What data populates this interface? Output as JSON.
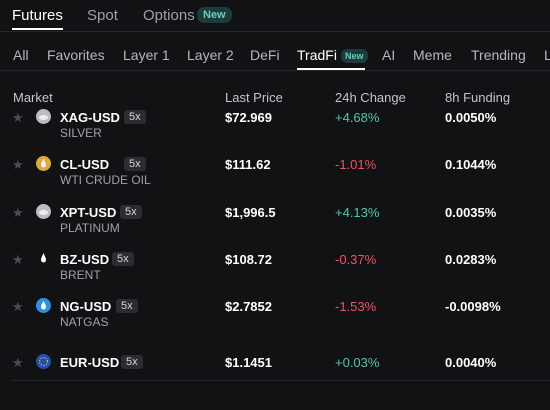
{
  "top_tabs": [
    {
      "label": "Futures",
      "active": true
    },
    {
      "label": "Spot",
      "active": false
    },
    {
      "label": "Options",
      "active": false,
      "badge": "New"
    }
  ],
  "category_tabs": [
    {
      "label": "All"
    },
    {
      "label": "Favorites"
    },
    {
      "label": "Layer 1"
    },
    {
      "label": "Layer 2"
    },
    {
      "label": "DeFi"
    },
    {
      "label": "TradFi",
      "active": true,
      "badge": "New"
    },
    {
      "label": "AI"
    },
    {
      "label": "Meme"
    },
    {
      "label": "Trending"
    },
    {
      "label": "L"
    }
  ],
  "columns": {
    "market": "Market",
    "last_price": "Last Price",
    "change": "24h Change",
    "funding": "8h Funding"
  },
  "rows": [
    {
      "symbol": "XAG-USD",
      "leverage": "5x",
      "name": "SILVER",
      "price": "$72.969",
      "change": "+4.68%",
      "change_dir": "pos",
      "funding": "0.0050%",
      "icon": "silver-coin-icon",
      "icon_color": "#b9bcc0"
    },
    {
      "symbol": "CL-USD",
      "leverage": "5x",
      "name": "WTI CRUDE OIL",
      "price": "$111.62",
      "change": "-1.01%",
      "change_dir": "neg",
      "funding": "0.1044%",
      "icon": "oil-drop-icon",
      "icon_color": "#e2a93a"
    },
    {
      "symbol": "XPT-USD",
      "leverage": "5x",
      "name": "PLATINUM",
      "price": "$1,996.5",
      "change": "+4.13%",
      "change_dir": "pos",
      "funding": "0.0035%",
      "icon": "platinum-coin-icon",
      "icon_color": "#b9bcc0"
    },
    {
      "symbol": "BZ-USD",
      "leverage": "5x",
      "name": "BRENT",
      "price": "$108.72",
      "change": "-0.37%",
      "change_dir": "neg",
      "funding": "0.0283%",
      "icon": "brent-drop-icon",
      "icon_color": "#111214"
    },
    {
      "symbol": "NG-USD",
      "leverage": "5x",
      "name": "NATGAS",
      "price": "$2.7852",
      "change": "-1.53%",
      "change_dir": "neg",
      "funding": "-0.0098%",
      "icon": "gas-flame-icon",
      "icon_color": "#2e8fe8"
    },
    {
      "symbol": "EUR-USD",
      "leverage": "5x",
      "name": "",
      "price": "$1.1451",
      "change": "+0.03%",
      "change_dir": "pos",
      "funding": "0.0040%",
      "icon": "euro-flag-icon",
      "icon_color": "#1f4fb8"
    }
  ]
}
